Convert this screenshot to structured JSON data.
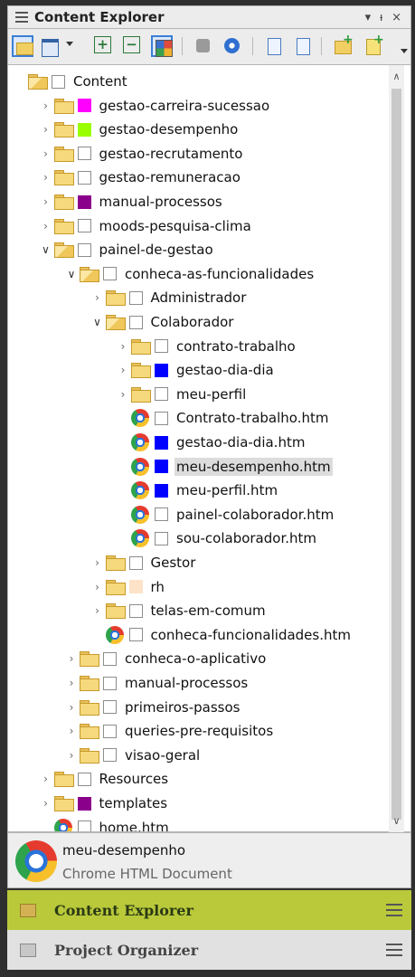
{
  "panel": {
    "title": "Content Explorer",
    "controls": {
      "dropdown": "▾",
      "pin": "ᵼ",
      "close": "×"
    }
  },
  "toolbar": {
    "buttons": [
      {
        "icon": "open-folder-icon"
      },
      {
        "icon": "document-icon"
      },
      {
        "icon": "expand-all-icon"
      },
      {
        "icon": "collapse-all-icon"
      },
      {
        "icon": "color-grid-icon"
      },
      {
        "icon": "gray-tool-icon"
      },
      {
        "icon": "refresh-icon"
      },
      {
        "icon": "page-icon"
      },
      {
        "icon": "search-page-icon"
      },
      {
        "icon": "new-folder-icon"
      },
      {
        "icon": "new-document-icon"
      }
    ]
  },
  "tree": [
    {
      "label": "Content",
      "kind": "folder",
      "level": 0,
      "expanded": true,
      "color": ""
    },
    {
      "label": "gestao-carreira-sucessao",
      "kind": "folder",
      "level": 1,
      "color": "#ff00ff"
    },
    {
      "label": "gestao-desempenho",
      "kind": "folder",
      "level": 1,
      "color": "#99ff00"
    },
    {
      "label": "gestao-recrutamento",
      "kind": "folder",
      "level": 1,
      "color": ""
    },
    {
      "label": "gestao-remuneracao",
      "kind": "folder",
      "level": 1,
      "color": ""
    },
    {
      "label": "manual-processos",
      "kind": "folder",
      "level": 1,
      "color": "#8b008b"
    },
    {
      "label": "moods-pesquisa-clima",
      "kind": "folder",
      "level": 1,
      "color": ""
    },
    {
      "label": "painel-de-gestao",
      "kind": "folder",
      "level": 1,
      "expanded": true,
      "color": ""
    },
    {
      "label": "conheca-as-funcionalidades",
      "kind": "folder",
      "level": 2,
      "expanded": true,
      "color": ""
    },
    {
      "label": "Administrador",
      "kind": "folder",
      "level": 3,
      "color": ""
    },
    {
      "label": "Colaborador",
      "kind": "folder",
      "level": 3,
      "expanded": true,
      "color": ""
    },
    {
      "label": "contrato-trabalho",
      "kind": "folder",
      "level": 4,
      "color": ""
    },
    {
      "label": "gestao-dia-dia",
      "kind": "folder",
      "level": 4,
      "color": "#0000ff"
    },
    {
      "label": "meu-perfil",
      "kind": "folder",
      "level": 4,
      "color": ""
    },
    {
      "label": "Contrato-trabalho.htm",
      "kind": "file",
      "level": 4,
      "color": ""
    },
    {
      "label": "gestao-dia-dia.htm",
      "kind": "file",
      "level": 4,
      "color": "#0000ff"
    },
    {
      "label": "meu-desempenho.htm",
      "kind": "file",
      "level": 4,
      "color": "#0000ff",
      "selected": true
    },
    {
      "label": "meu-perfil.htm",
      "kind": "file",
      "level": 4,
      "color": "#0000ff"
    },
    {
      "label": "painel-colaborador.htm",
      "kind": "file",
      "level": 4,
      "color": ""
    },
    {
      "label": "sou-colaborador.htm",
      "kind": "file",
      "level": 4,
      "color": ""
    },
    {
      "label": "Gestor",
      "kind": "folder",
      "level": 3,
      "color": ""
    },
    {
      "label": "rh",
      "kind": "folder",
      "level": 3,
      "color": "#fde3c8"
    },
    {
      "label": "telas-em-comum",
      "kind": "folder",
      "level": 3,
      "color": ""
    },
    {
      "label": "conheca-funcionalidades.htm",
      "kind": "file",
      "level": 3,
      "color": ""
    },
    {
      "label": "conheca-o-aplicativo",
      "kind": "folder",
      "level": 2,
      "color": ""
    },
    {
      "label": "manual-processos",
      "kind": "folder",
      "level": 2,
      "color": ""
    },
    {
      "label": "primeiros-passos",
      "kind": "folder",
      "level": 2,
      "color": ""
    },
    {
      "label": "queries-pre-requisitos",
      "kind": "folder",
      "level": 2,
      "color": ""
    },
    {
      "label": "visao-geral",
      "kind": "folder",
      "level": 2,
      "color": ""
    },
    {
      "label": "Resources",
      "kind": "folder",
      "level": 1,
      "color": ""
    },
    {
      "label": "templates",
      "kind": "folder",
      "level": 1,
      "color": "#8b008b"
    },
    {
      "label": "home.htm",
      "kind": "file",
      "level": 1,
      "color": ""
    }
  ],
  "details": {
    "name": "meu-desempenho",
    "type": "Chrome HTML Document"
  },
  "tabs": {
    "content_explorer": "Content Explorer",
    "project_organizer": "Project Organizer"
  }
}
